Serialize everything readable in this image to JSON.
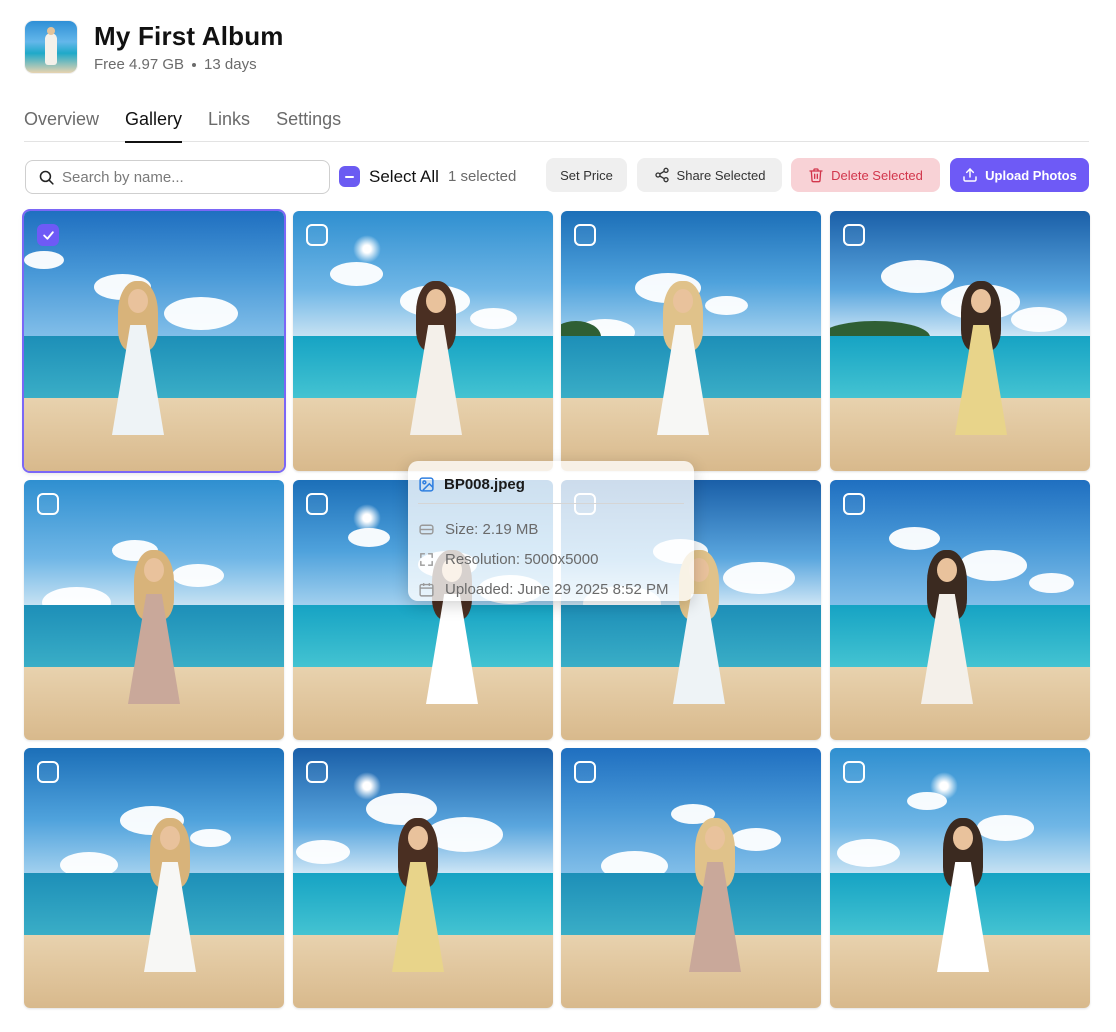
{
  "album": {
    "title": "My First Album",
    "free_space": "Free 4.97 GB",
    "days": "13 days"
  },
  "tabs": [
    {
      "label": "Overview",
      "active": false
    },
    {
      "label": "Gallery",
      "active": true
    },
    {
      "label": "Links",
      "active": false
    },
    {
      "label": "Settings",
      "active": false
    }
  ],
  "toolbar": {
    "search_placeholder": "Search by name...",
    "select_all_label": "Select All",
    "selected_count": "1 selected",
    "set_price_label": "Set Price",
    "share_label": "Share Selected",
    "delete_label": "Delete Selected",
    "upload_label": "Upload Photos"
  },
  "photos": [
    {
      "selected": true
    },
    {
      "selected": false
    },
    {
      "selected": false
    },
    {
      "selected": false
    },
    {
      "selected": false
    },
    {
      "selected": false
    },
    {
      "selected": false
    },
    {
      "selected": false
    },
    {
      "selected": false
    },
    {
      "selected": false
    },
    {
      "selected": false
    },
    {
      "selected": false
    }
  ],
  "tooltip": {
    "filename": "BP008.jpeg",
    "size": "Size: 2.19 MB",
    "resolution": "Resolution: 5000x5000",
    "uploaded": "Uploaded: June 29 2025 8:52 PM"
  },
  "colors": {
    "accent": "#6e5af6",
    "danger_bg": "#f8d2d6",
    "danger_text": "#d2364c"
  }
}
